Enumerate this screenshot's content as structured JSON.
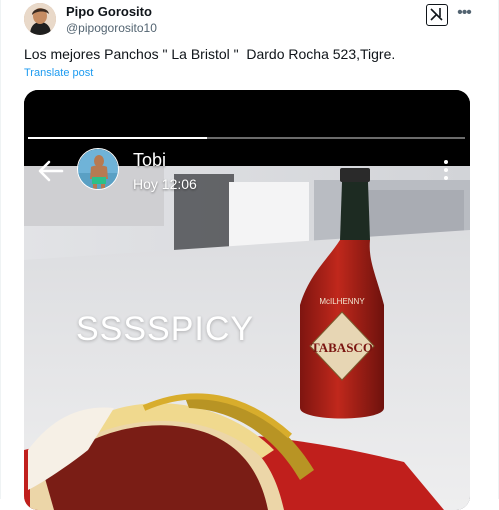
{
  "tweet": {
    "author_name": "Pipo Gorosito",
    "author_handle": "@pipogorosito10",
    "text": "Los mejores Panchos \" La Bristol \"  Dardo Rocha 523,Tigre.",
    "translate_label": "Translate post",
    "grok_icon": "grok-icon",
    "more_icon": "more-horizontal-icon",
    "avatar_icon": "avatar"
  },
  "story": {
    "username": "Tobi",
    "time": "Hoy 12:06",
    "caption": "SSSSPICY",
    "progress": 0.41,
    "back_icon": "arrow-left-icon",
    "more_icon": "more-vertical-icon"
  },
  "bottle": {
    "brand": "TABASCO",
    "curved_text": "McILHENNY"
  },
  "colors": {
    "link": "#1d9bf0",
    "text_primary": "#0f1419",
    "text_secondary": "#536471",
    "sauce_red": "#b3261e",
    "mustard": "#d9b13a"
  }
}
